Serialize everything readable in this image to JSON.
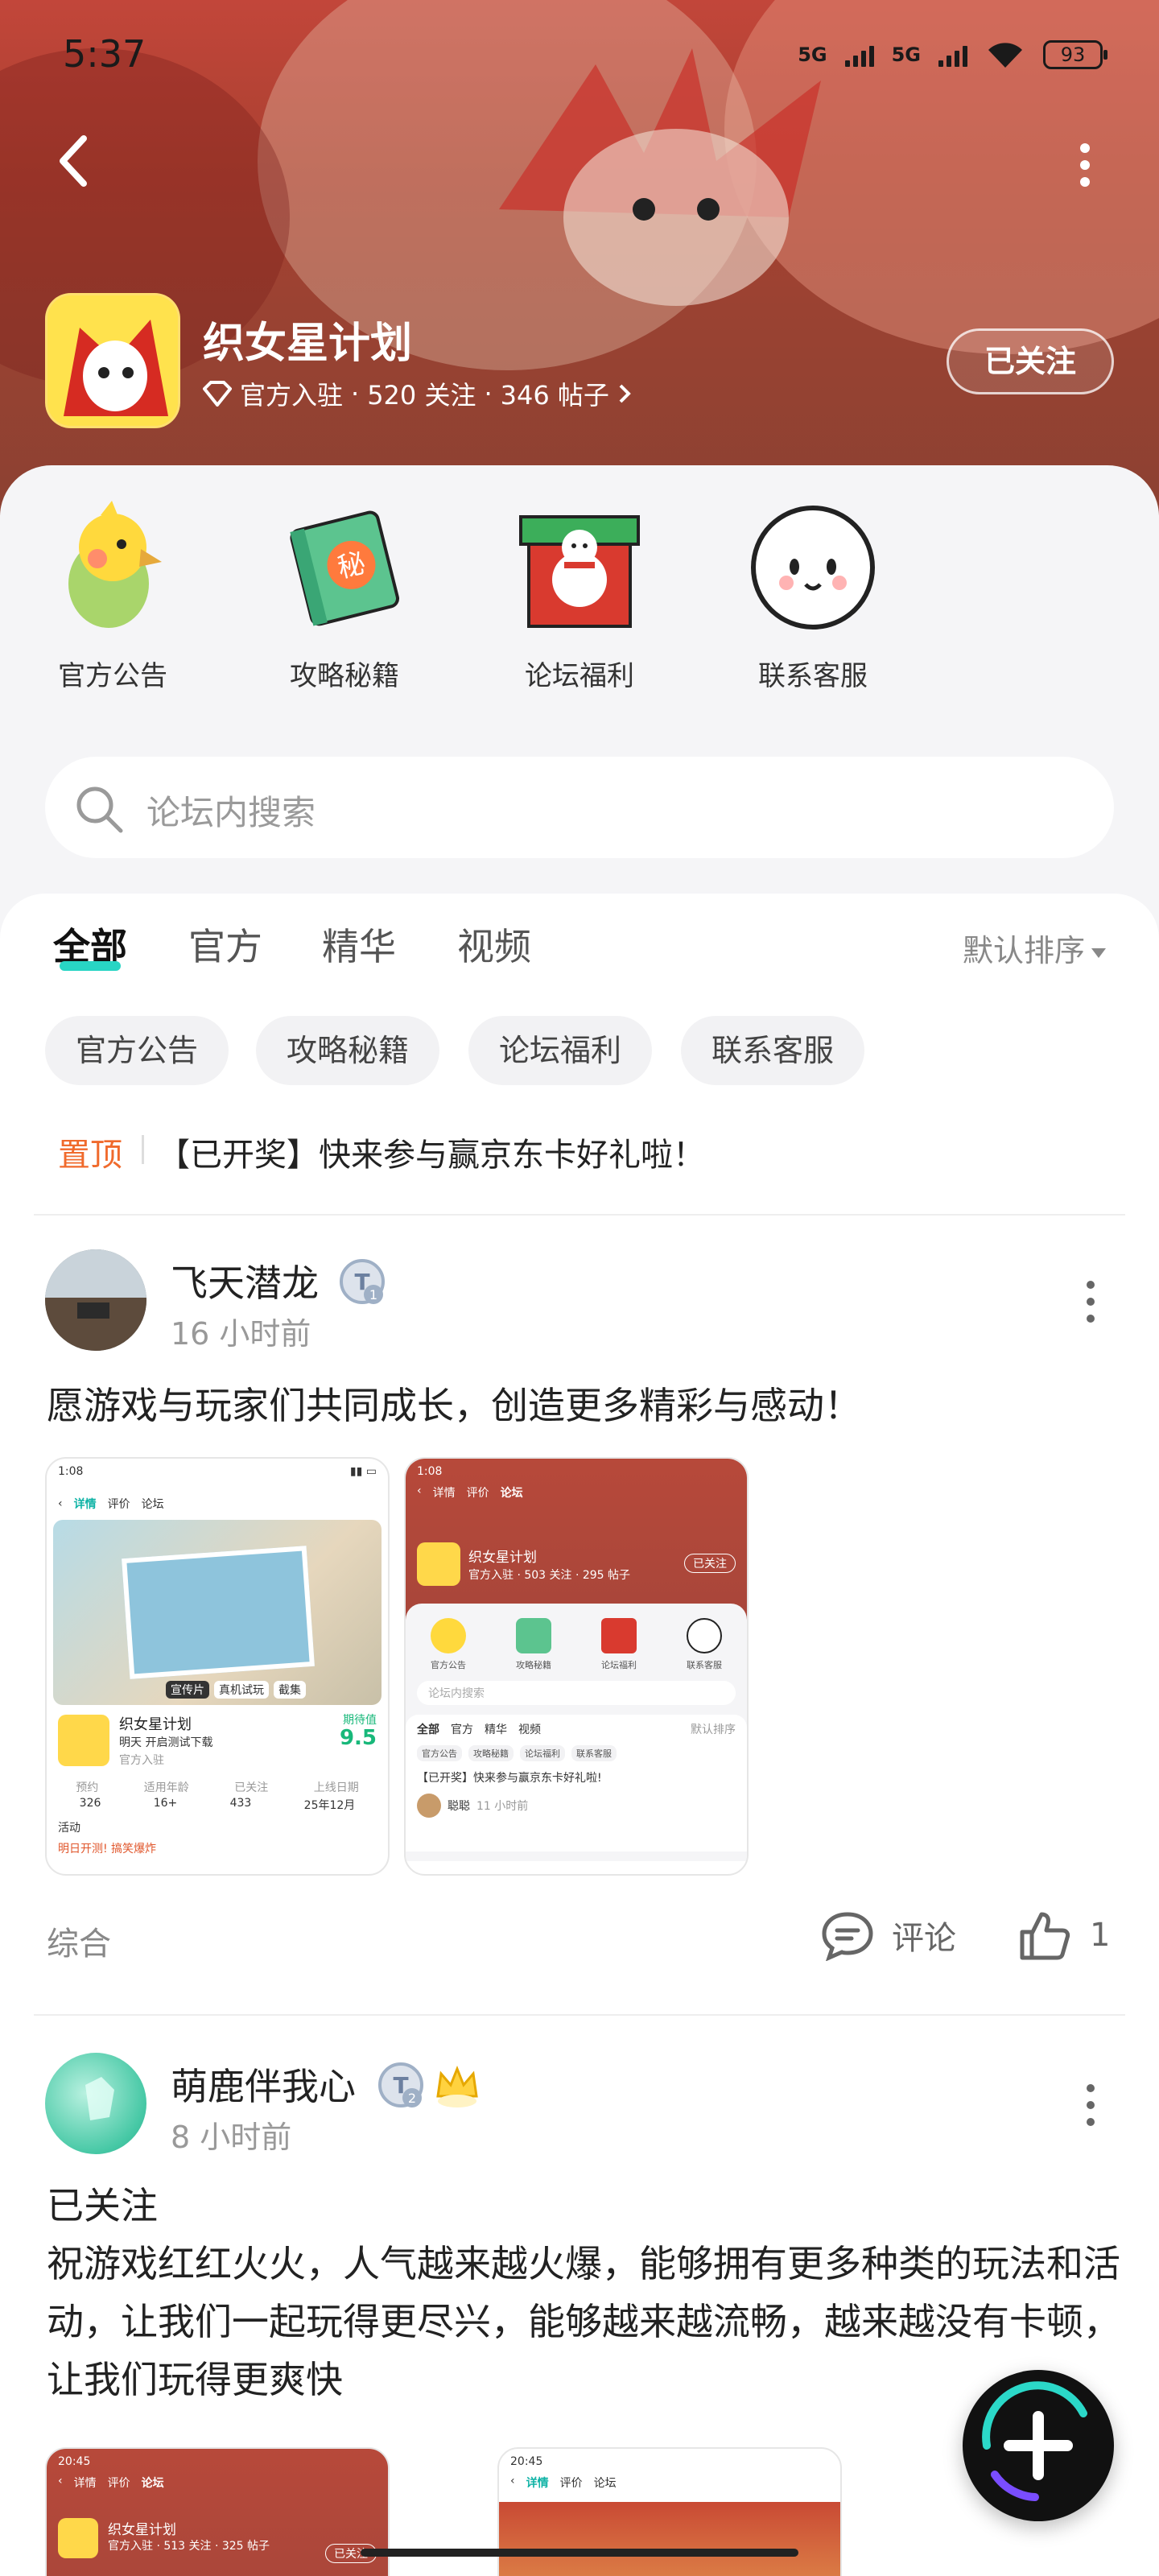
{
  "status_bar": {
    "time": "5:37",
    "net1": "5G",
    "net2": "5G",
    "battery": "93"
  },
  "header": {
    "title": "织女星计划",
    "verified": "官方入驻",
    "followers": "520 关注",
    "posts": "346 帖子",
    "sep": "·",
    "follow_label": "已关注"
  },
  "categories": [
    {
      "label": "官方公告",
      "icon": "parrot-icon"
    },
    {
      "label": "攻略秘籍",
      "icon": "secret-book-icon"
    },
    {
      "label": "论坛福利",
      "icon": "gift-box-icon"
    },
    {
      "label": "联系客服",
      "icon": "mascot-icon"
    }
  ],
  "search": {
    "placeholder": "论坛内搜索"
  },
  "tabs": [
    {
      "label": "全部",
      "active": true
    },
    {
      "label": "官方"
    },
    {
      "label": "精华"
    },
    {
      "label": "视频"
    }
  ],
  "sort_label": "默认排序",
  "chips": [
    "官方公告",
    "攻略秘籍",
    "论坛福利",
    "联系客服"
  ],
  "pinned": {
    "tag": "置顶",
    "text": "【已开奖】快来参与赢京东卡好礼啦！"
  },
  "posts": [
    {
      "author": "飞天潜龙",
      "time": "16 小时前",
      "badge_level": "1",
      "content": "愿游戏与玩家们共同成长，创造更多精彩与感动！",
      "topic": "综合",
      "comment_label": "评论",
      "likes": "1",
      "shot1": {
        "time": "1:08",
        "tabs": [
          "详情",
          "评价",
          "论坛"
        ],
        "game": "织女星计划",
        "tagline": "明天 开启测试下载",
        "rating_label": "期待值",
        "rating": "9.5",
        "media_tabs": [
          "宣传片",
          "真机试玩",
          "截集"
        ],
        "verified": "官方入驻",
        "stats_labels": [
          "预约",
          "适用年龄",
          "已关注",
          "上线日期"
        ],
        "stats_values": [
          "326",
          "16+",
          "433",
          "25年12月"
        ],
        "activity": "活动",
        "banner": "明日开测! 搞笑爆炸"
      },
      "shot2": {
        "time": "1:08",
        "tabs": [
          "详情",
          "评价",
          "论坛"
        ],
        "game": "织女星计划",
        "meta": "官方入驻 · 503 关注 · 295 帖子",
        "follow": "已关注",
        "cats": [
          "官方公告",
          "攻略秘籍",
          "论坛福利",
          "联系客服"
        ],
        "search": "论坛内搜索",
        "tabs2": [
          "全部",
          "官方",
          "精华",
          "视频"
        ],
        "sort": "默认排序",
        "chips": [
          "官方公告",
          "攻略秘籍",
          "论坛福利",
          "联系客服"
        ],
        "pinned": "【已开奖】快来参与赢京东卡好礼啦!",
        "user": "聪聪",
        "user_time": "11 小时前"
      }
    },
    {
      "author": "萌鹿伴我心",
      "time": "8 小时前",
      "badge_level": "2",
      "line1": "已关注",
      "content": "祝游戏红红火火，人气越来越火爆，能够拥有更多种类的玩法和活动，让我们一起玩得更尽兴，能够越来越流畅，越来越没有卡顿，让我们玩得更爽快",
      "shot1": {
        "time": "20:45",
        "tabs": [
          "详情",
          "评价",
          "论坛"
        ],
        "game": "织女星计划",
        "meta": "官方入驻 · 513 关注 · 325 帖子",
        "follow": "已关注"
      },
      "shot2": {
        "time": "20:45",
        "tabs": [
          "详情",
          "评价",
          "论坛"
        ]
      }
    }
  ],
  "colors": {
    "accent": "#28d5c4",
    "pinned": "#f06a2c",
    "hero": "#b0432f"
  }
}
